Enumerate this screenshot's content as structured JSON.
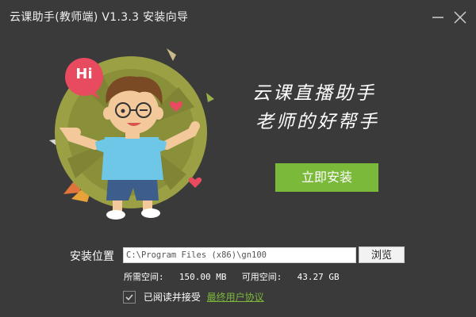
{
  "window": {
    "title": "云课助手(教师端) V1.3.3   安装向导"
  },
  "slogan": {
    "line1": "云课直播助手",
    "line2": "老师的好帮手"
  },
  "illustration": {
    "bubble_text": "Hi"
  },
  "install": {
    "button_label": "立即安装"
  },
  "location": {
    "label": "安装位置",
    "path_value": "C:\\Program Files (x86)\\gn100",
    "browse_label": "浏览"
  },
  "space": {
    "required_label": "所需空间:",
    "required_value": "150.00 MB",
    "available_label": "可用空间:",
    "available_value": "43.27 GB"
  },
  "agreement": {
    "checked": true,
    "text": "已阅读并接受",
    "link_text": "最终用户协议"
  },
  "colors": {
    "background": "#3a3a3a",
    "accent_green": "#7bb93a"
  }
}
